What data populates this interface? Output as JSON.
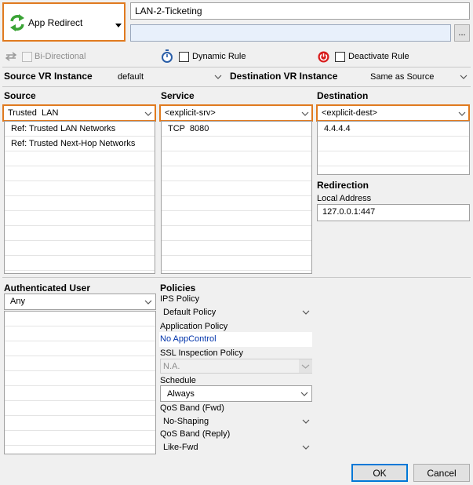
{
  "action": {
    "label": "App Redirect",
    "icon": "app-redirect-icon"
  },
  "rule_name": "LAN-2-Ticketing",
  "description_placeholder": "",
  "ellipsis_label": "...",
  "options": {
    "bidirectional": "Bi-Directional",
    "dynamic_rule": "Dynamic Rule",
    "deactivate_rule": "Deactivate Rule"
  },
  "vr": {
    "source_label": "Source VR Instance",
    "source_value": "default",
    "dest_label": "Destination VR Instance",
    "dest_value": "Same as Source"
  },
  "source": {
    "heading": "Source",
    "selected": "Trusted  LAN",
    "items": [
      "Ref: Trusted LAN Networks",
      "Ref: Trusted Next-Hop Networks"
    ]
  },
  "service": {
    "heading": "Service",
    "selected": "<explicit-srv>",
    "items": [
      "TCP  8080"
    ]
  },
  "destination": {
    "heading": "Destination",
    "selected": "<explicit-dest>",
    "items": [
      "4.4.4.4"
    ]
  },
  "redirection": {
    "heading": "Redirection",
    "local_address_label": "Local Address",
    "local_address_value": "127.0.0.1:447"
  },
  "auth_user": {
    "heading": "Authenticated User",
    "selected": "Any"
  },
  "policies": {
    "heading": "Policies",
    "ips_label": "IPS Policy",
    "ips_value": "Default Policy",
    "app_label": "Application Policy",
    "app_value": "No AppControl",
    "ssl_label": "SSL Inspection Policy",
    "ssl_value": "N.A.",
    "schedule_label": "Schedule",
    "schedule_value": "Always",
    "qos_fwd_label": "QoS Band (Fwd)",
    "qos_fwd_value": "No-Shaping",
    "qos_reply_label": "QoS Band (Reply)",
    "qos_reply_value": "Like-Fwd"
  },
  "buttons": {
    "ok": "OK",
    "cancel": "Cancel"
  },
  "colors": {
    "accent_orange": "#e07a1f",
    "link_blue": "#0033aa",
    "deactivate_red": "#d81b1b",
    "ok_border": "#0078d7"
  }
}
